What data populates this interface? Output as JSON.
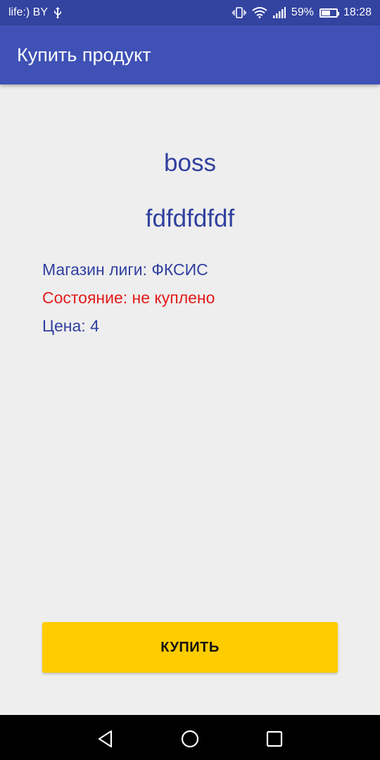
{
  "status_bar": {
    "carrier": "life:) BY",
    "battery_percent": "59%",
    "battery_level": 0.59,
    "time": "18:28",
    "icons": [
      "usb-icon",
      "vibrate-icon",
      "wifi-icon",
      "signal-icon",
      "battery-icon"
    ]
  },
  "app_bar": {
    "title": "Купить продукт"
  },
  "product": {
    "name": "boss",
    "description": "fdfdfdfdf",
    "shop": "Магазин лиги: ФКСИС",
    "state": "Состояние: не куплено",
    "price": "Цена: 4"
  },
  "buy_button": {
    "label": "КУПИТЬ"
  },
  "colors": {
    "status_bar": "#3343a0",
    "app_bar": "#3f51b5",
    "text_primary": "#303f9f",
    "state_red": "#e31b1b",
    "button": "#ffcc00",
    "background": "#eeeeee"
  },
  "nav_bar": {
    "icons": [
      "back-icon",
      "home-icon",
      "recent-apps-icon"
    ]
  }
}
